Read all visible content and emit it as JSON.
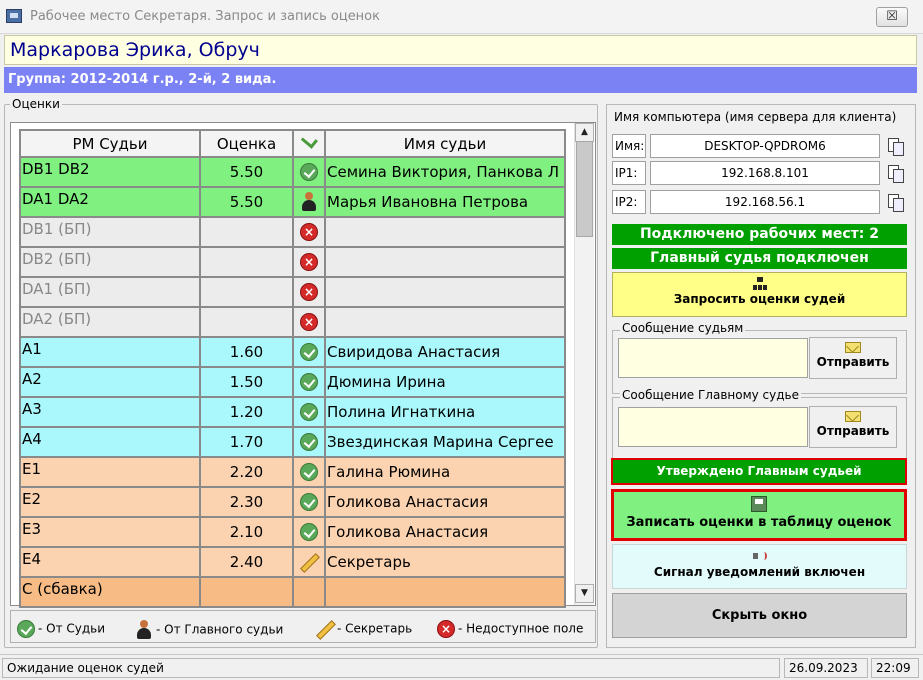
{
  "window": {
    "title": "Рабочее место Секретаря. Запрос и запись оценок",
    "close_label": "☒"
  },
  "athlete": "Маркарова Эрика, Обруч",
  "group": "Группа: 2012-2014 г.р., 2-й, 2 вида.",
  "scores": {
    "legend": "Оценки",
    "columns": [
      "РМ Судьи",
      "Оценка",
      "check-icon",
      "Имя судьи"
    ],
    "rows": [
      {
        "rm": "DB1 DB2",
        "score": "5.50",
        "status": "ok",
        "judge": "Семина Виктория, Панкова Л",
        "color": "green"
      },
      {
        "rm": "DA1 DA2",
        "score": "5.50",
        "status": "chief",
        "judge": "Марья Ивановна Петрова",
        "color": "green"
      },
      {
        "rm": "DB1 (БП)",
        "score": "",
        "status": "unavailable",
        "judge": "",
        "color": "gray"
      },
      {
        "rm": "DB2 (БП)",
        "score": "",
        "status": "unavailable",
        "judge": "",
        "color": "gray"
      },
      {
        "rm": "DA1 (БП)",
        "score": "",
        "status": "unavailable",
        "judge": "",
        "color": "gray"
      },
      {
        "rm": "DA2 (БП)",
        "score": "",
        "status": "unavailable",
        "judge": "",
        "color": "gray"
      },
      {
        "rm": "A1",
        "score": "1.60",
        "status": "ok",
        "judge": "Свиридова Анастасия",
        "color": "cyan"
      },
      {
        "rm": "A2",
        "score": "1.50",
        "status": "ok",
        "judge": "Дюмина Ирина",
        "color": "cyan"
      },
      {
        "rm": "A3",
        "score": "1.20",
        "status": "ok",
        "judge": "Полина Игнаткина",
        "color": "cyan"
      },
      {
        "rm": "A4",
        "score": "1.70",
        "status": "ok",
        "judge": "Звездинская Марина Сергее",
        "color": "cyan"
      },
      {
        "rm": "E1",
        "score": "2.20",
        "status": "ok",
        "judge": "Галина Рюмина",
        "color": "peach"
      },
      {
        "rm": "E2",
        "score": "2.30",
        "status": "ok",
        "judge": "Голикова Анастасия",
        "color": "peach"
      },
      {
        "rm": "E3",
        "score": "2.10",
        "status": "ok",
        "judge": "Голикова Анастасия",
        "color": "peach"
      },
      {
        "rm": "E4",
        "score": "2.40",
        "status": "secretary",
        "judge": "Секретарь",
        "color": "peach"
      },
      {
        "rm": "С (сбавка)",
        "score": "",
        "status": "none",
        "judge": "",
        "color": "orange"
      }
    ]
  },
  "legend_bar": {
    "from_judge": "- От Судьи",
    "from_chief": "- От Главного судьи",
    "secretary": "- Секретарь",
    "unavailable": "- Недоступное поле"
  },
  "connection": {
    "label": "Имя компьютера (имя сервера для клиента)",
    "name_label": "Имя:",
    "name_value": "DESKTOP-QPDROM6",
    "ip1_label": "IP1:",
    "ip1_value": "192.168.8.101",
    "ip2_label": "IP2:",
    "ip2_value": "192.168.56.1"
  },
  "status": {
    "connected": "Подключено рабочих мест:  2",
    "chief_connected": "Главный судья подключен"
  },
  "buttons": {
    "request": "Запросить оценки судей",
    "send": "Отправить",
    "write": "Записать оценки в таблицу оценок",
    "signal": "Сигнал уведомлений включен",
    "hide": "Скрыть окно"
  },
  "messages": {
    "to_judges": "Сообщение судьям",
    "to_chief": "Сообщение Главному судье"
  },
  "approved": "Утверждено Главным судьей",
  "statusbar": {
    "text": "Ожидание оценок судей",
    "date": "26.09.2023",
    "time": "22:09"
  },
  "colors": {
    "green_row": "#80f080",
    "cyan_row": "#aaf8fc",
    "peach_row": "#fcd3b0",
    "group_bar": "#7b82f4",
    "status_green": "#00a000",
    "highlight_red": "#e00000"
  }
}
